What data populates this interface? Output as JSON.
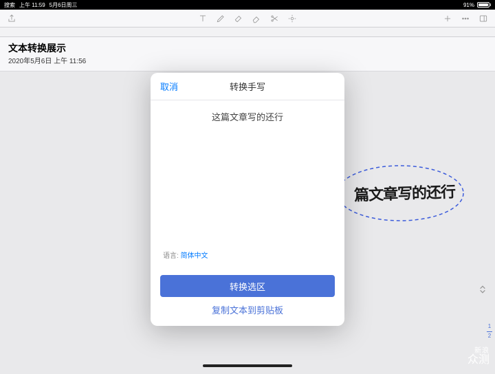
{
  "status": {
    "search": "搜索",
    "time": "上午 11:59",
    "date": "5月6日周三",
    "battery": "91%"
  },
  "note": {
    "title": "文本转换展示",
    "date": "2020年5月6日 上午 11:56"
  },
  "handwriting": {
    "text": "篇文章写的还行"
  },
  "modal": {
    "cancel": "取消",
    "title": "转换手写",
    "converted": "这篇文章写的还行",
    "lang_label": "语言:",
    "lang_value": "简体中文",
    "primary_btn": "转换选区",
    "secondary_btn": "复制文本到剪贴板"
  },
  "pager": {
    "current": "1",
    "total": "2"
  },
  "watermark": {
    "line1": "新浪",
    "line2": "众测"
  }
}
